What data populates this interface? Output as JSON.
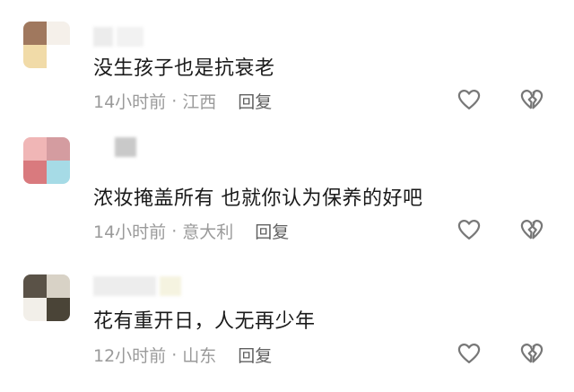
{
  "comments": [
    {
      "text": "没生孩子也是抗衰老",
      "time": "14小时前",
      "location": "江西",
      "reply_label": "回复",
      "avatar_colors": [
        "#a0785e",
        "#f5f0ea",
        "#f1dba8",
        "#ffffff"
      ]
    },
    {
      "text": "浓妆掩盖所有  也就你认为保养的好吧",
      "time": "14小时前",
      "location": "意大利",
      "reply_label": "回复",
      "avatar_colors": [
        "#f0b6b6",
        "#d49ca0",
        "#d97a7e",
        "#a6dbe6"
      ]
    },
    {
      "text": "花有重开日，人无再少年",
      "time": "12小时前",
      "location": "山东",
      "reply_label": "回复",
      "avatar_colors": [
        "#5a5247",
        "#d8d2c6",
        "#f2efe9",
        "#4a4437"
      ]
    }
  ],
  "separator": "·",
  "icons": {
    "like": "heart-outline-icon",
    "dislike": "broken-heart-icon"
  },
  "colors": {
    "text": "#1a1a1a",
    "meta": "#9a9a9a",
    "reply": "#606060",
    "icon": "#777777"
  }
}
